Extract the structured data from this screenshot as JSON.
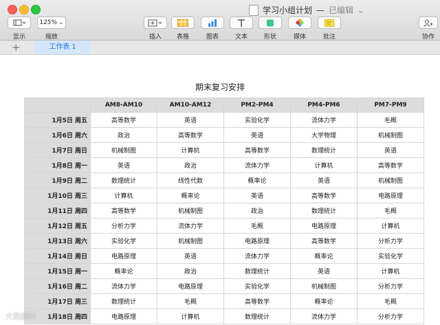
{
  "window": {
    "title": "学习小组计划",
    "status": "已编辑"
  },
  "toolbar": {
    "view": {
      "label": "显示"
    },
    "zoom": {
      "value": "125%",
      "label": "缩放"
    },
    "insert": {
      "label": "插入"
    },
    "table": {
      "label": "表格"
    },
    "chart": {
      "label": "图表"
    },
    "text": {
      "label": "文本"
    },
    "shape": {
      "label": "形状"
    },
    "media": {
      "label": "媒体"
    },
    "comment": {
      "label": "批注"
    },
    "collaborate": {
      "label": "协作"
    }
  },
  "sheets": {
    "add_symbol": "+",
    "tabs": [
      "工作表 1"
    ]
  },
  "table": {
    "title": "期末复习安排",
    "columns": [
      "AM8-AM10",
      "AM10-AM12",
      "PM2-PM4",
      "PM4-PM6",
      "PM7-PM9"
    ],
    "rows": [
      {
        "day": "1月5日 周五",
        "cells": [
          "高等数学",
          "英语",
          "实验化学",
          "流体力学",
          "毛概"
        ]
      },
      {
        "day": "1月6日 周六",
        "cells": [
          "政治",
          "高等数学",
          "英语",
          "大学物理",
          "机械制图"
        ]
      },
      {
        "day": "1月7日 周日",
        "cells": [
          "机械制图",
          "计算机",
          "高等数学",
          "数理统计",
          "英语"
        ]
      },
      {
        "day": "1月8日 周一",
        "cells": [
          "英语",
          "政治",
          "流体力学",
          "计算机",
          "高等数学"
        ]
      },
      {
        "day": "1月9日 周二",
        "cells": [
          "数理统计",
          "线性代数",
          "概率论",
          "英语",
          "机械制图"
        ]
      },
      {
        "day": "1月10日 周三",
        "cells": [
          "计算机",
          "概率论",
          "英语",
          "高等数学",
          "电路原理"
        ]
      },
      {
        "day": "1月11日 周四",
        "cells": [
          "高等数学",
          "机械制图",
          "政治",
          "数理统计",
          "毛概"
        ]
      },
      {
        "day": "1月12日 周五",
        "cells": [
          "分析力学",
          "流体力学",
          "毛概",
          "电路原理",
          "计算机"
        ]
      },
      {
        "day": "1月13日 周六",
        "cells": [
          "实验化学",
          "机械制图",
          "电路原理",
          "高等数学",
          "分析力学"
        ]
      },
      {
        "day": "1月14日 周日",
        "cells": [
          "电路原理",
          "英语",
          "流体力学",
          "概率论",
          "实验化学"
        ]
      },
      {
        "day": "1月15日 周一",
        "cells": [
          "概率论",
          "政治",
          "数理统计",
          "英语",
          "计算机"
        ]
      },
      {
        "day": "1月16日 周二",
        "cells": [
          "流体力学",
          "电路原理",
          "实验化学",
          "机械制图",
          "分析力学"
        ]
      },
      {
        "day": "1月17日 周三",
        "cells": [
          "数理统计",
          "毛概",
          "高等数学",
          "概率论",
          "毛概"
        ]
      },
      {
        "day": "1月18日 周四",
        "cells": [
          "电路原理",
          "计算机",
          "数理统计",
          "流体力学",
          "分析力学"
        ]
      }
    ]
  },
  "watermark": "大数据风"
}
